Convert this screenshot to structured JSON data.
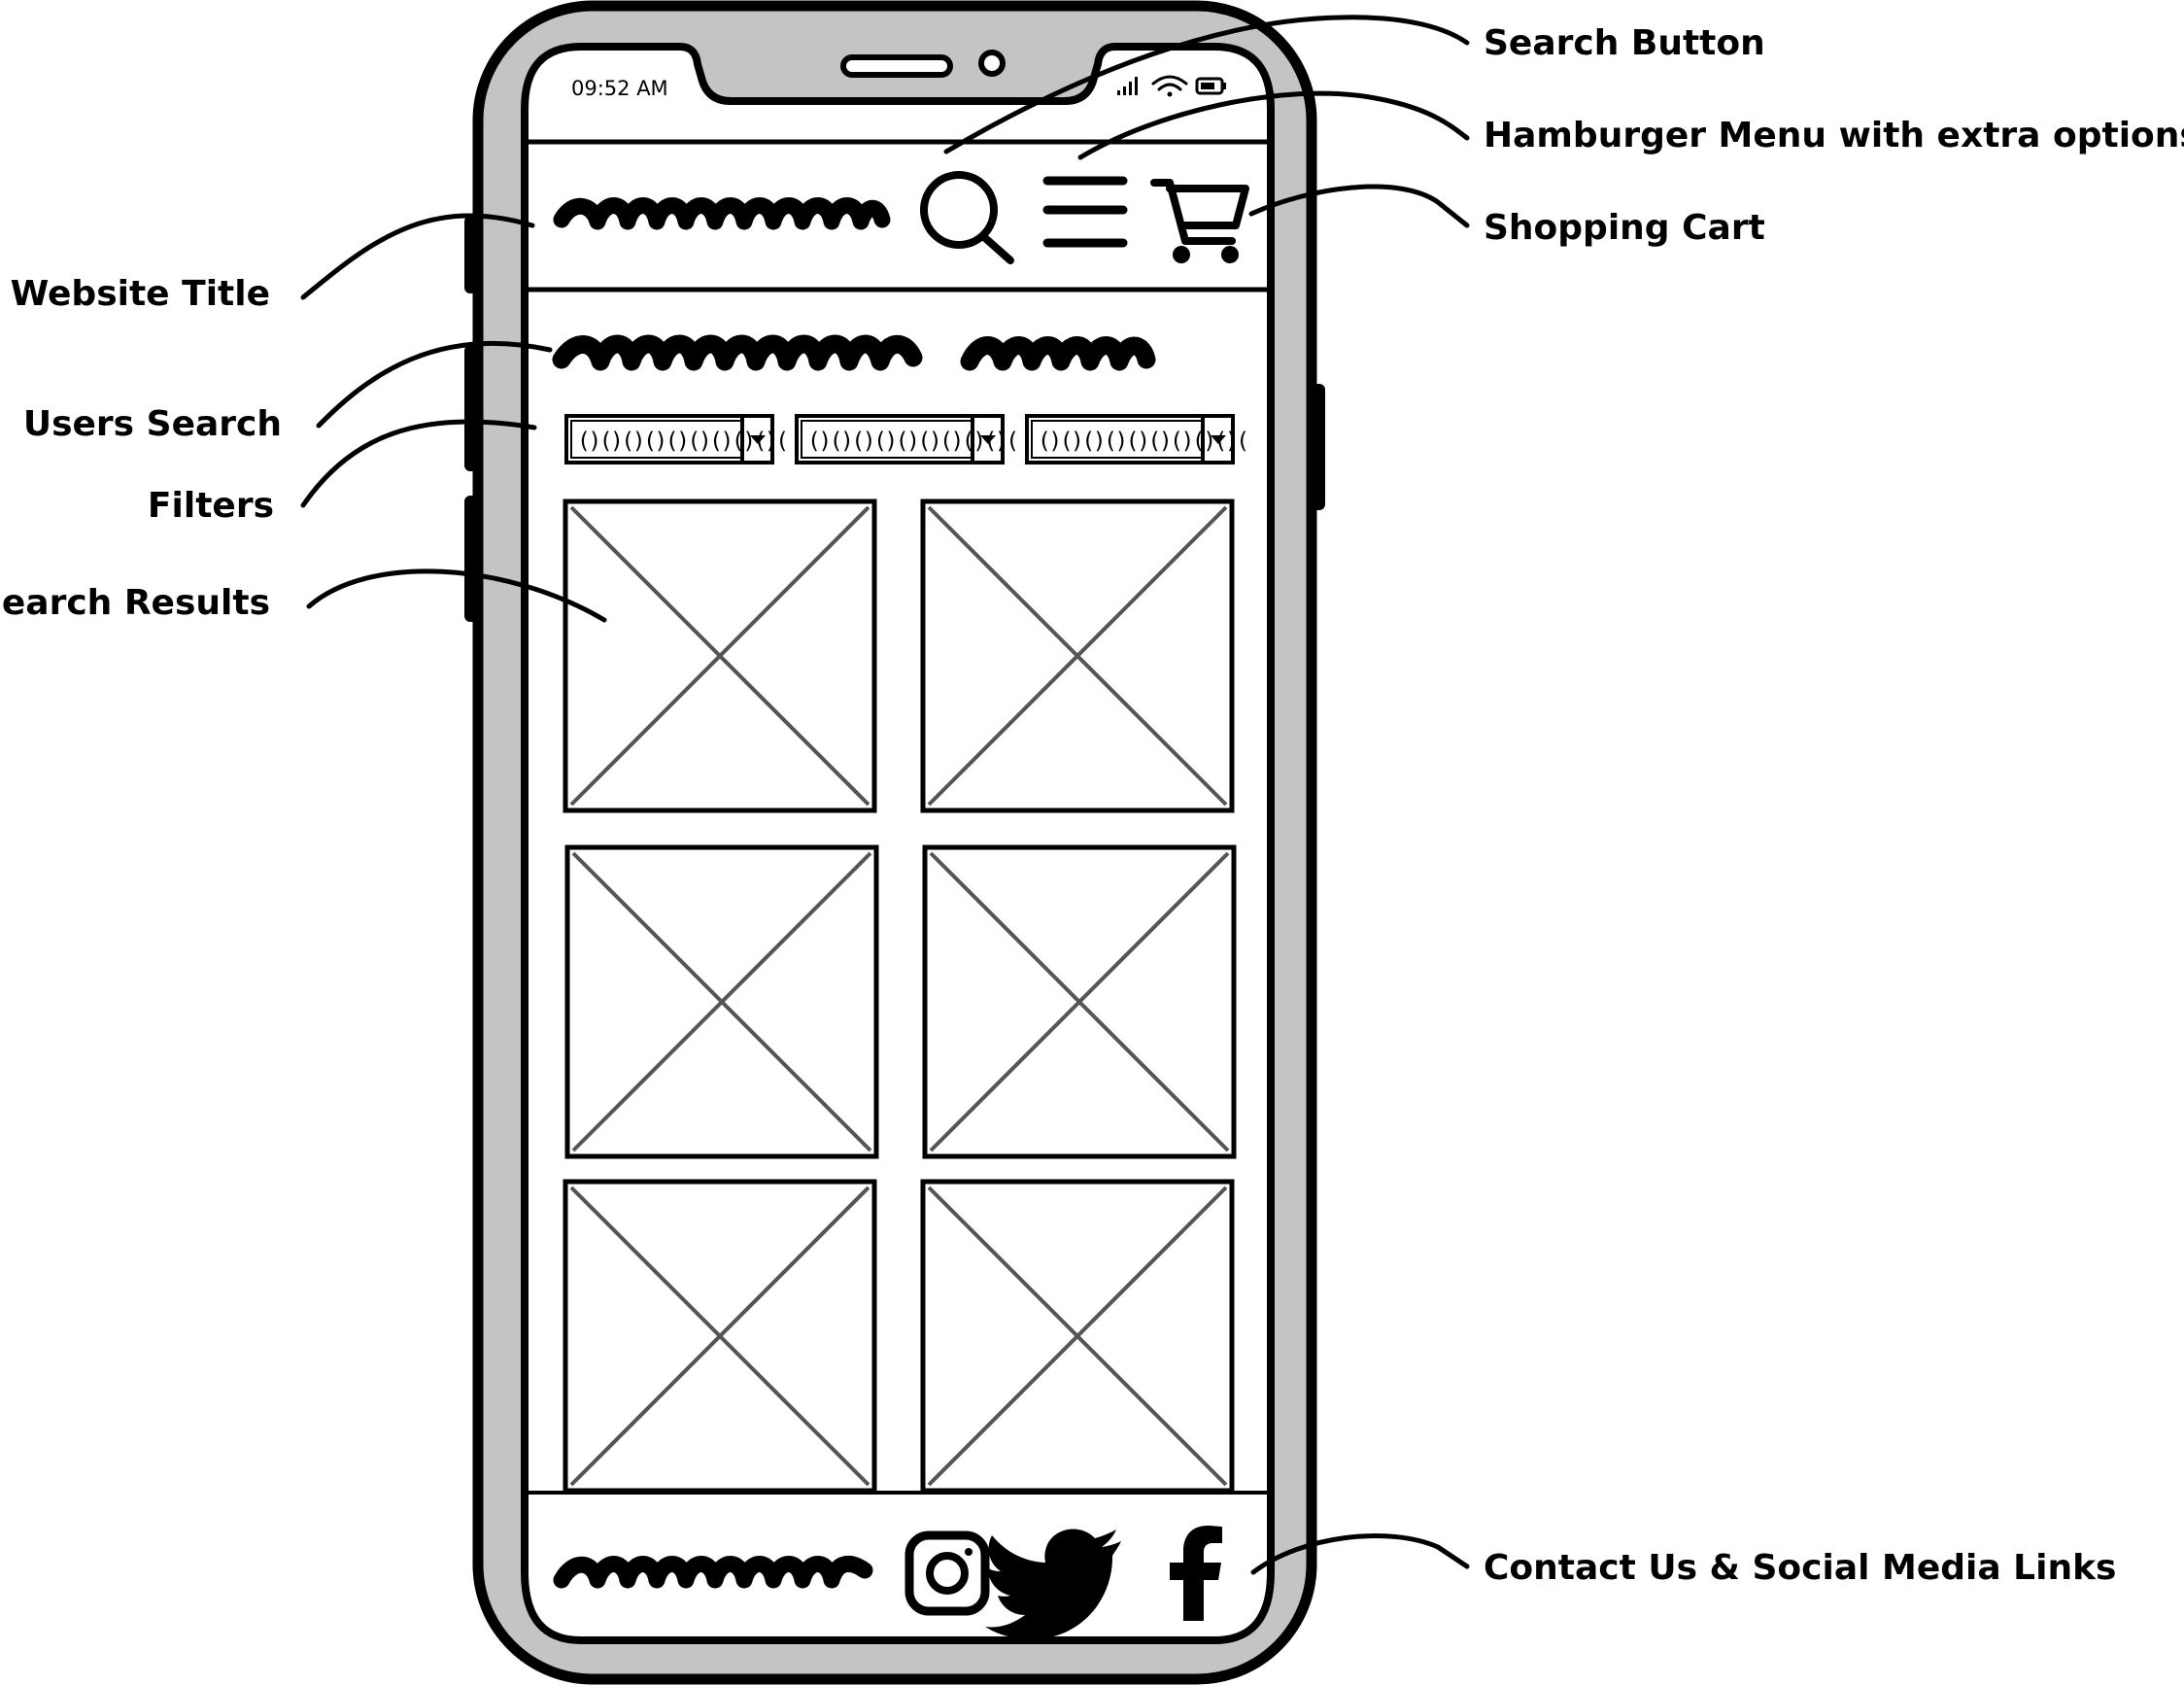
{
  "colors": {
    "ink": "#000000",
    "phone_frame": "#c4c4c4",
    "screen": "#ffffff",
    "placeholder_cross": "#555555"
  },
  "status_bar": {
    "time": "09:52 AM",
    "icons": [
      "signal-icon",
      "wifi-icon",
      "battery-icon"
    ]
  },
  "header": {
    "title_placeholder": "scribble",
    "icons": [
      "search-icon",
      "hamburger-menu-icon",
      "shopping-cart-icon"
    ]
  },
  "filters": [
    {
      "value": "()()()()()()()()()("
    },
    {
      "value": "()()()()()()()()()("
    },
    {
      "value": "()()()()()()()()()("
    }
  ],
  "results": [
    {
      "type": "image-placeholder"
    },
    {
      "type": "image-placeholder"
    },
    {
      "type": "image-placeholder"
    },
    {
      "type": "image-placeholder"
    },
    {
      "type": "image-placeholder"
    },
    {
      "type": "image-placeholder"
    }
  ],
  "footer": {
    "icons": [
      "instagram-icon",
      "twitter-icon",
      "facebook-icon"
    ]
  },
  "callouts": {
    "search_button": "Search Button",
    "hamburger_menu": "Hamburger Menu with extra options",
    "shopping_cart": "Shopping Cart",
    "website_title": "Website Title",
    "users_search": "Users Search",
    "filters": "Filters",
    "search_results": "Search Results",
    "contact_social": "Contact Us & Social Media Links"
  }
}
